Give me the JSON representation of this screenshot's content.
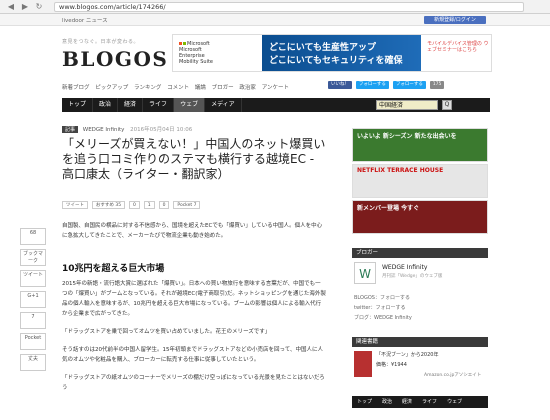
{
  "browser": {
    "url": "www.blogos.com/article/174266/"
  },
  "topbar": {
    "links": "livedoor ニュース",
    "register": "新規登録/ログイン"
  },
  "site": {
    "tagline": "意見をつなぐ。日本が変わる。",
    "logo": "BLOGOS"
  },
  "banner": {
    "ms_line1": "Microsoft",
    "ms_line2": "Microsoft",
    "ms_line3": "Enterprise",
    "ms_line4": "Mobility Suite",
    "text1": "どこにいても生産性アップ",
    "text2": "どこにいてもセキュリティを確保",
    "right": "モバイルデバイス管理の ウェブセミナーはこちら"
  },
  "subnav": [
    "新着ブログ",
    "ピックアップ",
    "ランキング",
    "コメント",
    "議論",
    "ブロガー",
    "政治家",
    "アンケート"
  ],
  "socials": [
    "いいね！",
    "フォローする",
    "フォローする",
    "175"
  ],
  "mainnav": [
    "トップ",
    "政治",
    "経済",
    "ライフ",
    "ウェブ",
    "メディア"
  ],
  "search": {
    "value": "中国経済",
    "button": "Q"
  },
  "article": {
    "category": "記事",
    "author": "WEDGE Infinity",
    "date": "2016年05月04日 10:06",
    "title": "「メリーズが買えない！」中国人のネット爆買いを追う口コミ作りのステマも横行する越境EC - 高口康太（ライター・翻訳家）",
    "share": [
      "ツイート",
      "おすすめ 35",
      "0",
      "1",
      "0",
      "Pocket 7"
    ],
    "lead": "自国製、自国民の横品に対する不信感から、国境を超えたECでも「爆買い」している中国人。個人を中心に急拡大してきたことで、メーカーたびで物流企業も動き始めた。",
    "h2": "10兆円を超える巨大市場",
    "p1": "2015年の新語・流行語大賞に選ばれた「爆買い」。日本への買い物旅行を意味する言葉だが、中国でも一つの「爆買い」がブームとなっている。それが越境EC(電子商取引)だ。ネットショッピングを通じた海外製品の個人輸入を意味するが、10兆円を超える巨大市場になっている。ブームの影響は個人による輸入代行から企業まで広がってきた。",
    "quote": "「ドラッグストアを乗で回ってオムツを買い占めていました。花王のメリーズです」",
    "p2": "そう話すのは20代前半の中国人留学生。15年初頭までドラッグストアなどの小売店を回って、中国人に人気のオムツや化粧品を購入、ブローカーに転売する仕事に従事していたという。",
    "p3": "「ドラッグストアの紙オムツのコーナーでメリーズの棚だけ空っぽになっている光景を見たことはないだろう"
  },
  "side_share": [
    {
      "label": "68"
    },
    {
      "label": "1"
    },
    {
      "label": "ブックマーク"
    },
    {
      "label": "ツイート"
    },
    {
      "label": "0"
    },
    {
      "label": "G+1"
    },
    {
      "label": "7"
    },
    {
      "label": "Pocket"
    },
    {
      "label": "1"
    },
    {
      "label": "丈夫"
    }
  ],
  "right_ads": [
    {
      "text": "いよいよ 新シーズン 新たな出会いを"
    },
    {
      "text": "NETFLIX TERRACE HOUSE"
    },
    {
      "text": "新メンバー登場 今すぐ"
    }
  ],
  "blogger": {
    "header": "ブロガー",
    "name": "WEDGE Infinity",
    "desc": "月刊誌「Wedge」のウェブ版",
    "rows": [
      "BLOGOS：フォローする",
      "twitter：フォローする",
      "ブログ：WEDGE Infinity"
    ]
  },
  "related": {
    "header": "関連書籍",
    "title": "「不況ブーン」から2020年",
    "price": "価格：¥1944",
    "amazon": "Amazon.co.jpアソシエイト"
  },
  "footnav": [
    "トップ",
    "政治",
    "経済",
    "ライフ",
    "ウェブ",
    "メディア"
  ]
}
